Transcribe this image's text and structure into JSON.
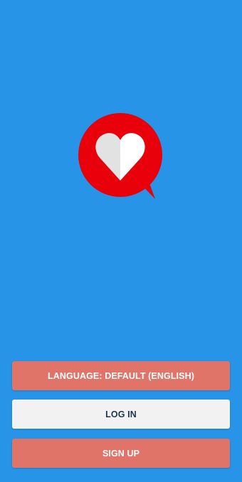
{
  "colors": {
    "background": "#2794e8",
    "accent_button": "#e07469",
    "neutral_button": "#f2f2f2",
    "logo_red": "#e8000a",
    "logo_heart_light": "#e2e2e2",
    "logo_heart_white": "#ffffff"
  },
  "logo": {
    "icon": "heart-speech-bubble-icon"
  },
  "buttons": {
    "language_label": "LANGUAGE: DEFAULT (ENGLISH)",
    "login_label": "LOG IN",
    "signup_label": "SIGN UP"
  }
}
